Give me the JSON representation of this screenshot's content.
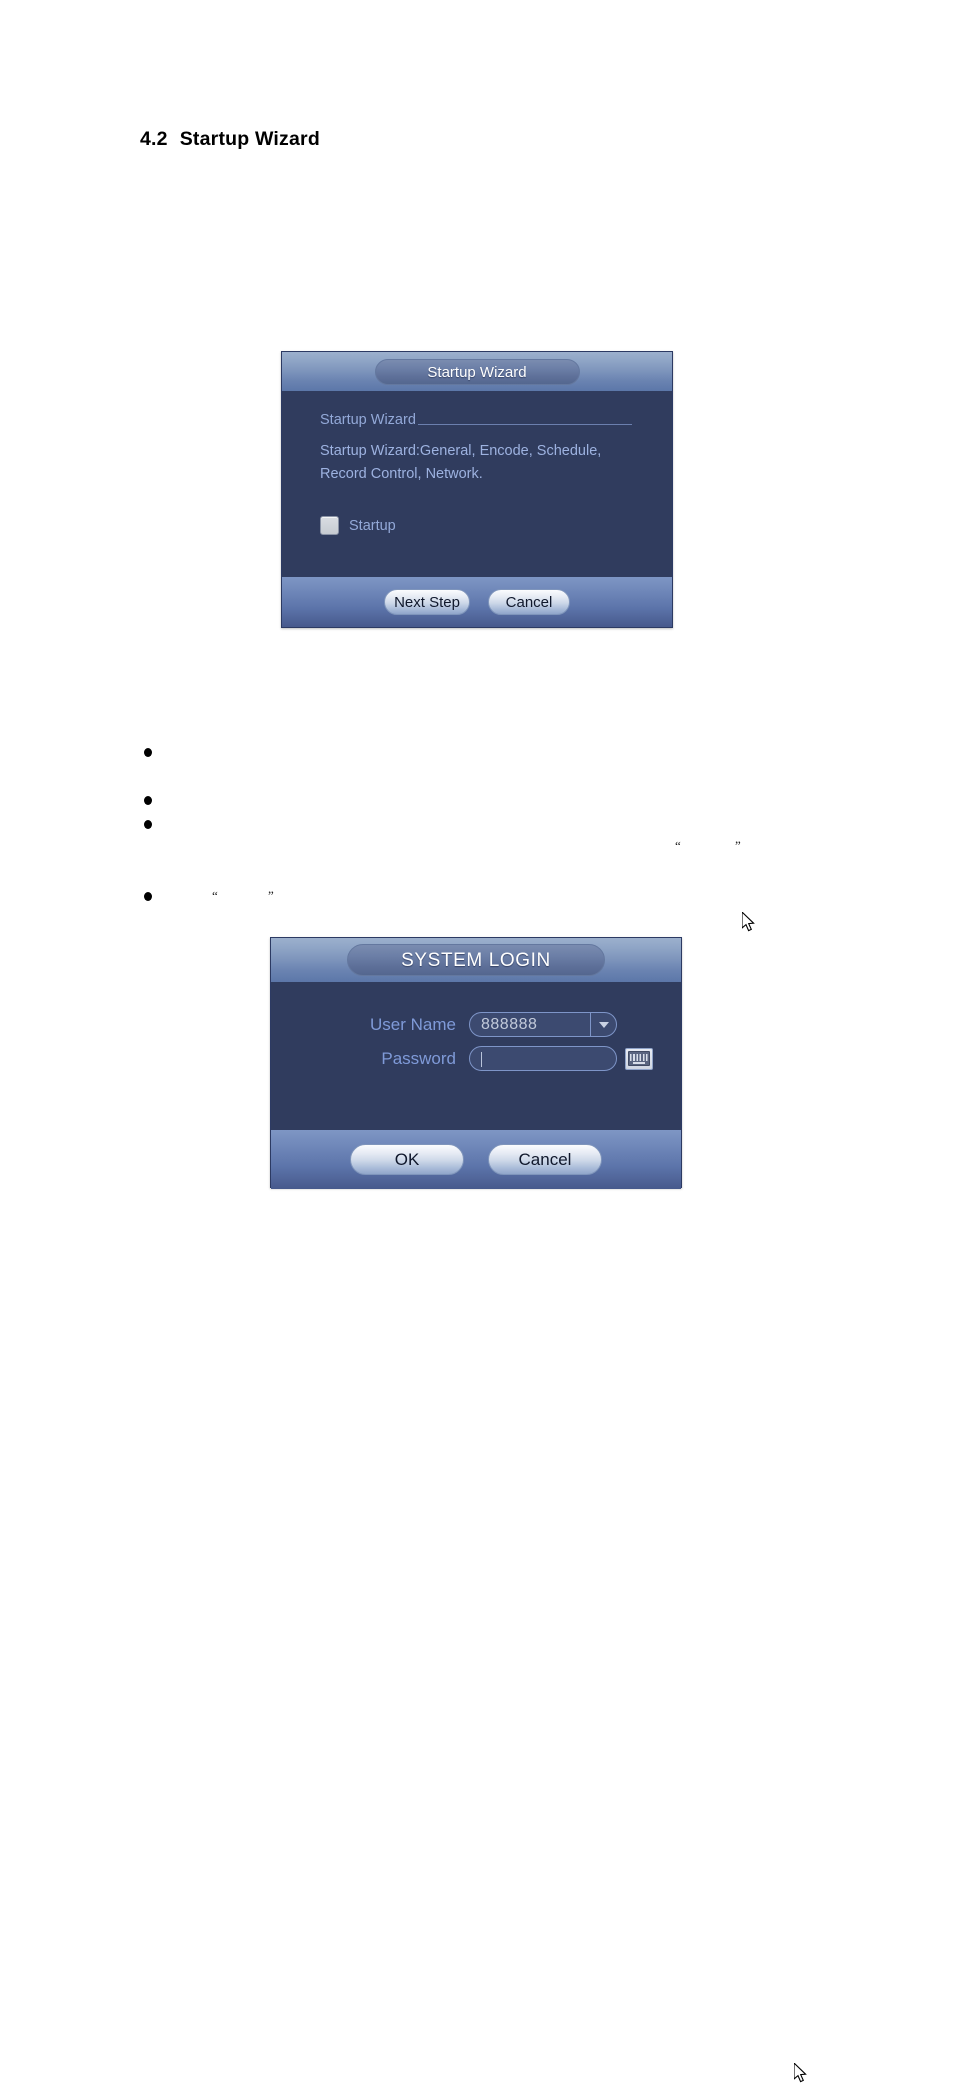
{
  "document": {
    "heading_number": "4.2",
    "heading_text": "Startup Wizard"
  },
  "startup_wizard_dialog": {
    "title": "Startup Wizard",
    "section_label": "Startup Wizard",
    "description": "Startup Wizard:General, Encode, Schedule, Record Control, Network.",
    "checkbox_label": "Startup",
    "checkbox_checked": false,
    "next_button": "Next Step",
    "cancel_button": "Cancel",
    "cursor_icon": "arrow-pointer-icon",
    "colors": {
      "body_background": "#303c5e",
      "title_text": "#ffffff",
      "label_text": "#93a9d8",
      "description_text": "#9db2e0"
    }
  },
  "system_login_dialog": {
    "title": "SYSTEM LOGIN",
    "fields": [
      {
        "label": "User Name",
        "value": "888888",
        "placeholder": "",
        "type": "combobox",
        "icon": "chevron-down-icon"
      },
      {
        "label": "Password",
        "value": "",
        "placeholder": "",
        "type": "password",
        "icon": "keyboard-icon"
      }
    ],
    "ok_button": "OK",
    "cancel_button": "Cancel",
    "cursor_icon": "arrow-pointer-icon",
    "colors": {
      "body_background": "#303c5e",
      "title_text": "#ffffff",
      "label_text": "#7f9ad8",
      "value_text": "#c2cada"
    }
  },
  "bullet_list": {
    "items": [
      "",
      "",
      "",
      ""
    ]
  },
  "quote_marks": {
    "upper_open": "“",
    "upper_close": "”",
    "lower_open": "“",
    "lower_close": "”"
  }
}
